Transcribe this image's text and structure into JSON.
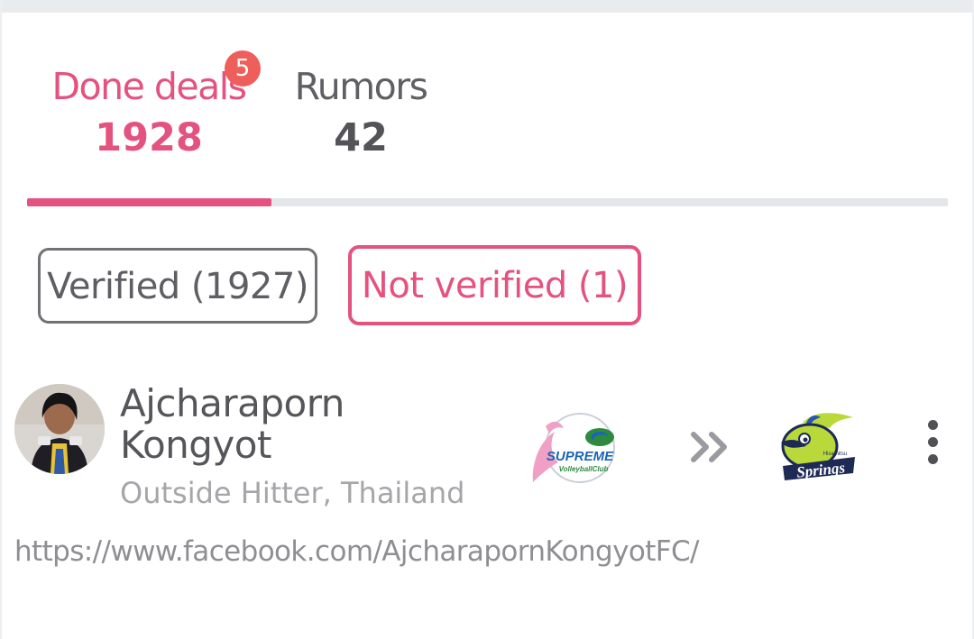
{
  "tabs": {
    "done": {
      "label": "Done deals",
      "count": "1928",
      "badge": "5"
    },
    "rumors": {
      "label": "Rumors",
      "count": "42"
    }
  },
  "filters": {
    "verified": "Verified (1927)",
    "not_verified": "Not verified (1)"
  },
  "transfer": {
    "player_name_line1": "Ajcharaporn",
    "player_name_line2": "Kongyot",
    "position": "Outside Hitter, Thailand",
    "source_url": "https://www.facebook.com/AjcharapornKongyotFC/",
    "from_club": {
      "name": "Supreme Volleyball Club",
      "logo_text": "SUPREME",
      "logo_subtext": "VolleyballClub",
      "icon": "supreme-club-logo"
    },
    "to_club": {
      "name": "Springs",
      "logo_text": "Springs",
      "logo_subtext": "Hisamitsu",
      "icon": "springs-club-logo"
    }
  },
  "colors": {
    "accent": "#e4527f",
    "badge": "#ee5e5a",
    "text_dark": "#55555a",
    "text_muted": "#a6a6aa"
  }
}
